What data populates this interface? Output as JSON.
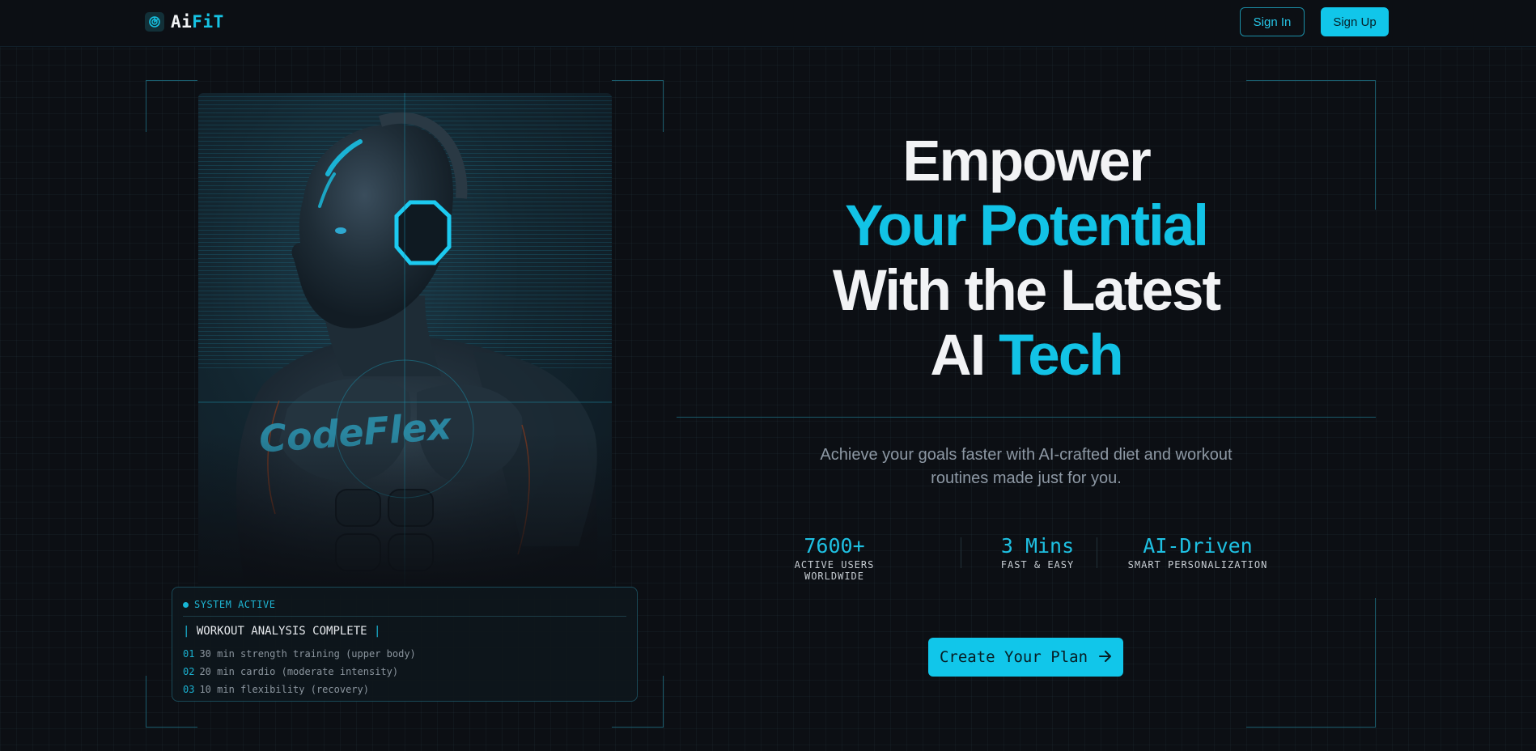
{
  "header": {
    "brand_ai": "Ai",
    "brand_fit": "FiT",
    "sign_in_label": "Sign In",
    "sign_up_label": "Sign Up"
  },
  "hero": {
    "headline_line1": "Empower",
    "headline_line2": "Your Potential",
    "headline_line3": "With the Latest",
    "headline_line4_plain": "AI",
    "headline_line4_accent": "Tech",
    "subtitle": "Achieve your goals faster with AI-crafted diet and workout routines made just for you.",
    "cta_label": "Create Your Plan"
  },
  "stats": [
    {
      "value": "7600+",
      "label": "ACTIVE USERS WORLDWIDE"
    },
    {
      "value": "3 Mins",
      "label": "FAST & EASY"
    },
    {
      "value": "AI-Driven",
      "label": "SMART PERSONALIZATION"
    }
  ],
  "image": {
    "chest_text": "CodeFlex"
  },
  "system_card": {
    "status": "SYSTEM ACTIVE",
    "title": "WORKOUT ANALYSIS COMPLETE",
    "items": [
      {
        "num": "01",
        "text": "30 min strength training (upper body)"
      },
      {
        "num": "02",
        "text": "20 min cardio (moderate intensity)"
      },
      {
        "num": "03",
        "text": "10 min flexibility (recovery)"
      }
    ]
  },
  "colors": {
    "accent": "#11c6ea",
    "background": "#0c0f14"
  },
  "icons": [
    "brand-logo-icon",
    "arrow-right-icon",
    "status-dot-icon"
  ]
}
